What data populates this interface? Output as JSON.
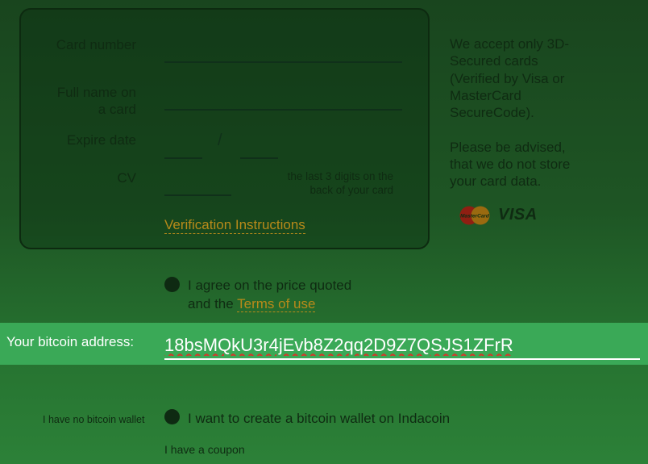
{
  "card_form": {
    "card_number_label": "Card number",
    "full_name_label_line1": "Full name on",
    "full_name_label_line2": "a card",
    "expire_label": "Expire date",
    "expire_separator": "/",
    "cv_label": "CV",
    "cv_hint_line1": "the last 3 digits on the",
    "cv_hint_line2": "back of your card",
    "verification_link": "Verification Instructions"
  },
  "side_info": {
    "accept_lines": [
      "We accept only 3D-",
      "Secured cards",
      "(Verified by Visa or",
      "MasterCard",
      "SecureCode)."
    ],
    "advise_lines": [
      "Please be advised,",
      "that we do not store",
      "your card data."
    ],
    "mastercard_logo_text": "MasterCard",
    "visa_logo_text": "VISA"
  },
  "agree": {
    "line1": "I agree on the price quoted",
    "line2_prefix": "and the ",
    "terms_link": "Terms of use"
  },
  "bitcoin": {
    "label": "Your bitcoin address:",
    "value": "18bsMQkU3r4jEvb8Z2qq2D9Z7QSJS1ZFrR"
  },
  "wallet": {
    "no_wallet_label": "I have no bitcoin wallet",
    "create_wallet_text": "I want to create a bitcoin wallet on Indacoin"
  },
  "coupon": {
    "label": "I have a coupon"
  },
  "colors": {
    "accent_link": "#b88a1a",
    "bitcoin_band": "#3aa957"
  }
}
